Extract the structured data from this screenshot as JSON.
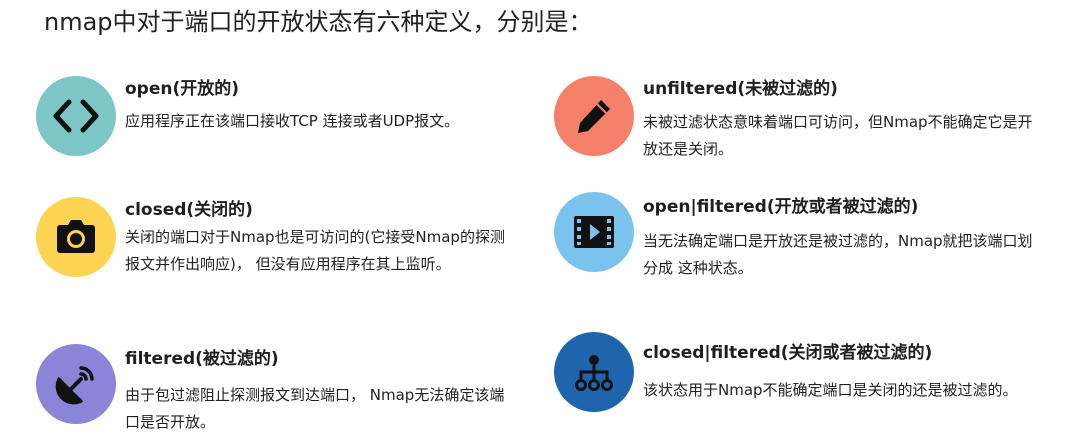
{
  "heading": "nmap中对于端口的开放状态有六种定义，分别是：",
  "colors": {
    "open": "#7cc6c6",
    "closed": "#fdd352",
    "filtered": "#8a85d6",
    "unfiltered": "#f5806a",
    "open_filtered": "#79c3ec",
    "closed_filtered": "#1f65ad"
  },
  "states": {
    "open": {
      "icon": "code-brackets-icon",
      "title": "open(开放的)",
      "description": "应用程序正在该端口接收TCP 连接或者UDP报文。"
    },
    "closed": {
      "icon": "camera-icon",
      "title": "closed(关闭的)",
      "description": "关闭的端口对于Nmap也是可访问的(它接受Nmap的探测报文并作出响应)， 但没有应用程序在其上监听。"
    },
    "filtered": {
      "icon": "satellite-dish-icon",
      "title": "filtered(被过滤的)",
      "description": "由于包过滤阻止探测报文到达端口， Nmap无法确定该端口是否开放。"
    },
    "unfiltered": {
      "icon": "pencil-icon",
      "title": "unfiltered(未被过滤的)",
      "description": "未被过滤状态意味着端口可访问，但Nmap不能确定它是开放还是关闭。"
    },
    "open_filtered": {
      "icon": "film-icon",
      "title": "open|filtered(开放或者被过滤的)",
      "description": "当无法确定端口是开放还是被过滤的，Nmap就把该端口划分成 这种状态。"
    },
    "closed_filtered": {
      "icon": "sitemap-icon",
      "title": "closed|filtered(关闭或者被过滤的)",
      "description": "该状态用于Nmap不能确定端口是关闭的还是被过滤的。"
    }
  }
}
